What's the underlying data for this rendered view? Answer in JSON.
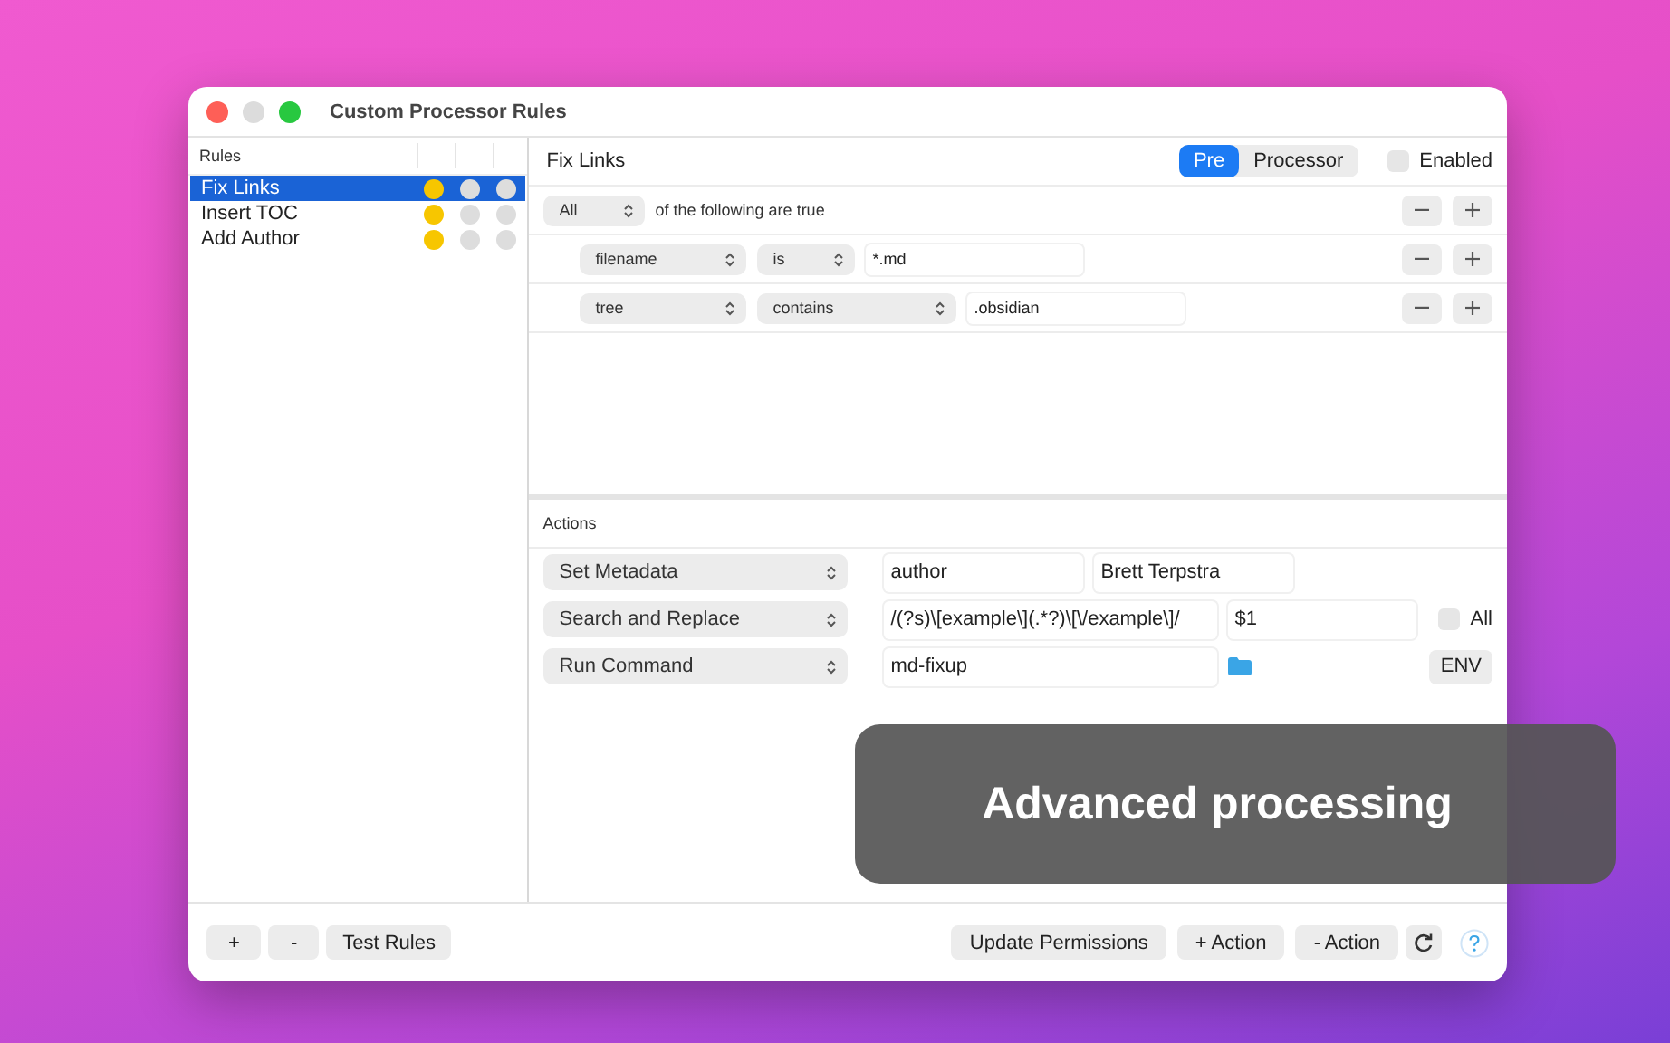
{
  "window": {
    "title": "Custom Processor Rules"
  },
  "sidebar": {
    "header": "Rules",
    "rules": [
      {
        "name": "Fix Links",
        "selected": true,
        "dots": [
          {
            "color": "#f7c600"
          },
          {
            "color": "#dddddd"
          },
          {
            "color": "#dddddd"
          }
        ]
      },
      {
        "name": "Insert TOC",
        "selected": false,
        "dots": [
          {
            "color": "#f7c600"
          },
          {
            "color": "#dddddd"
          },
          {
            "color": "#dddddd"
          }
        ]
      },
      {
        "name": "Add Author",
        "selected": false,
        "dots": [
          {
            "color": "#f7c600"
          },
          {
            "color": "#dddddd"
          },
          {
            "color": "#dddddd"
          }
        ]
      }
    ]
  },
  "rule_editor": {
    "name": "Fix Links",
    "segments": [
      {
        "label": "Pre",
        "selected": true
      },
      {
        "label": "Processor",
        "selected": false
      }
    ],
    "enabled": {
      "label": "Enabled",
      "checked": false
    },
    "match": {
      "quantifier": "All",
      "text": "of the following are true"
    },
    "conditions": [
      {
        "field": "filename",
        "operator": "is",
        "value": "*.md"
      },
      {
        "field": "tree",
        "operator": "contains",
        "value": ".obsidian"
      }
    ]
  },
  "actions": {
    "header": "Actions",
    "rows": [
      {
        "kind": "metadata",
        "action": "Set Metadata",
        "key": "author",
        "value": "Brett Terpstra"
      },
      {
        "kind": "replace",
        "action": "Search and Replace",
        "search": "/(?s)\\[example\\](.*?)\\[\\/example\\]/",
        "replace": "$1",
        "all": {
          "label": "All",
          "checked": false
        }
      },
      {
        "kind": "command",
        "action": "Run Command",
        "command": "md-fixup",
        "env": "ENV"
      }
    ]
  },
  "footer": {
    "left_buttons": [
      "+",
      "-",
      "Test Rules"
    ],
    "right_buttons": [
      "Update Permissions",
      "+ Action",
      "- Action"
    ]
  },
  "caption": "Advanced processing"
}
